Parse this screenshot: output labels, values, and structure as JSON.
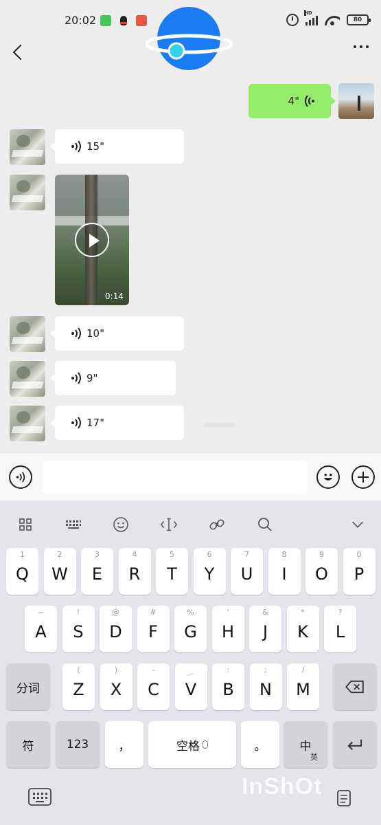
{
  "status_bar": {
    "time": "20:02",
    "battery": "80"
  },
  "chat": {
    "messages": [
      {
        "from": "me",
        "type": "voice",
        "duration": "4\""
      },
      {
        "from": "friend",
        "type": "voice",
        "duration": "15\""
      },
      {
        "from": "friend",
        "type": "video",
        "duration": "0:14"
      },
      {
        "from": "friend",
        "type": "voice",
        "duration": "10\""
      },
      {
        "from": "friend",
        "type": "voice",
        "duration": "9\""
      },
      {
        "from": "friend",
        "type": "voice",
        "duration": "17\""
      }
    ]
  },
  "keyboard": {
    "row1": [
      {
        "hint": "1",
        "key": "Q"
      },
      {
        "hint": "2",
        "key": "W"
      },
      {
        "hint": "3",
        "key": "E"
      },
      {
        "hint": "4",
        "key": "R"
      },
      {
        "hint": "5",
        "key": "T"
      },
      {
        "hint": "6",
        "key": "Y"
      },
      {
        "hint": "7",
        "key": "U"
      },
      {
        "hint": "8",
        "key": "I"
      },
      {
        "hint": "9",
        "key": "O"
      },
      {
        "hint": "0",
        "key": "P"
      }
    ],
    "row2": [
      {
        "hint": "~",
        "key": "A"
      },
      {
        "hint": "!",
        "key": "S"
      },
      {
        "hint": "@",
        "key": "D"
      },
      {
        "hint": "#",
        "key": "F"
      },
      {
        "hint": "%",
        "key": "G"
      },
      {
        "hint": "'",
        "key": "H"
      },
      {
        "hint": "&",
        "key": "J"
      },
      {
        "hint": "*",
        "key": "K"
      },
      {
        "hint": "?",
        "key": "L"
      }
    ],
    "row3": [
      {
        "hint": "(",
        "key": "Z"
      },
      {
        "hint": ")",
        "key": "X"
      },
      {
        "hint": "-",
        "key": "C"
      },
      {
        "hint": "_",
        "key": "V"
      },
      {
        "hint": ":",
        "key": "B"
      },
      {
        "hint": ";",
        "key": "N"
      },
      {
        "hint": "/",
        "key": "M"
      }
    ],
    "segment_key": "分词",
    "symbol_key": "符",
    "num_key": "123",
    "comma_key": "，",
    "space_key": "空格",
    "period_key": "。",
    "lang_key": "中",
    "lang_sub": "英"
  },
  "watermark": "InShOt",
  "colors": {
    "bubble_out": "#95ec69",
    "accent_overlay": "#1b7bf2"
  }
}
